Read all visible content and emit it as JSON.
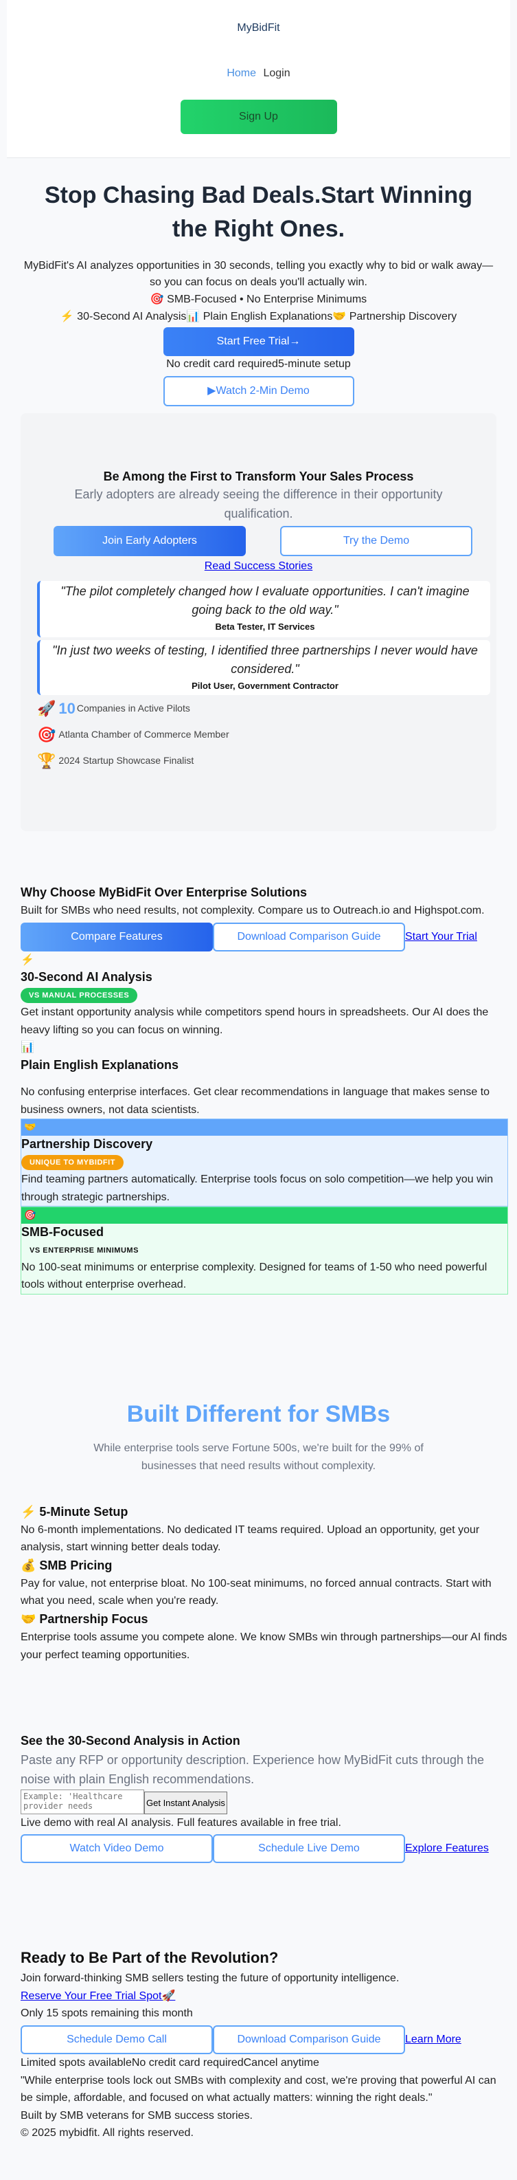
{
  "header": {
    "logo": "MyBidFit",
    "nav_home": "Home",
    "nav_login": "Login",
    "signup": "Sign Up"
  },
  "hero": {
    "title": "Stop Chasing Bad Deals.Start Winning the Right Ones.",
    "subtitle": "MyBidFit's AI analyzes opportunities in 30 seconds, telling you exactly why to bid or walk away—so you can focus on deals you'll actually win.",
    "tagline": "🎯 SMB-Focused • No Enterprise Minimums",
    "features_line": "⚡ 30-Second AI Analysis📊 Plain English Explanations🤝 Partnership Discovery",
    "cta": "Start Free Trial→",
    "note": "No credit card required5-minute setup",
    "watch": "▶Watch 2-Min Demo"
  },
  "early": {
    "title": "Be Among the First to Transform Your Sales Process",
    "lead": "Early adopters are already seeing the difference in their opportunity qualification.",
    "join": "Join Early Adopters",
    "try": "Try the Demo",
    "read": "Read Success Stories",
    "quotes": [
      {
        "text": "\"The pilot completely changed how I evaluate opportunities. I can't imagine going back to the old way.\"",
        "by": "Beta Tester, IT Services"
      },
      {
        "text": "\"In just two weeks of testing, I identified three partnerships I never would have considered.\"",
        "by": "Pilot User, Government Contractor"
      }
    ],
    "badges": [
      {
        "icon": "🚀",
        "num": "10",
        "label": "Companies in Active Pilots"
      },
      {
        "icon": "🎯",
        "label": "Atlanta Chamber of Commerce Member"
      },
      {
        "icon": "🏆",
        "label": "2024 Startup Showcase Finalist"
      }
    ]
  },
  "why": {
    "title": "Why Choose MyBidFit Over Enterprise Solutions",
    "lead": "Built for SMBs who need results, not complexity. Compare us to Outreach.io and Highspot.com.",
    "compare": "Compare Features",
    "download": "Download Comparison Guide",
    "trial": "Start Your Trial",
    "features": [
      {
        "icon": "⚡",
        "title": "30-Second AI Analysis",
        "pill": "VS MANUAL PROCESSES",
        "text": "Get instant opportunity analysis while competitors spend hours in spreadsheets. Our AI does the heavy lifting so you can focus on winning."
      },
      {
        "icon": "📊",
        "title": "Plain English Explanations",
        "pill": "",
        "text": "No confusing enterprise interfaces. Get clear recommendations in language that makes sense to business owners, not data scientists."
      },
      {
        "icon": "🤝",
        "title": "Partnership Discovery",
        "pill": "UNIQUE TO MYBIDFIT",
        "text": "Find teaming partners automatically. Enterprise tools focus on solo competition—we help you win through strategic partnerships."
      },
      {
        "icon": "🎯",
        "title": "SMB-Focused",
        "pill": "VS ENTERPRISE MINIMUMS",
        "text": "No 100-seat minimums or enterprise complexity. Designed for teams of 1-50 who need powerful tools without enterprise overhead."
      }
    ]
  },
  "built": {
    "title": "Built Different for SMBs",
    "sub": "While enterprise tools serve Fortune 500s, we're built for the 99% of businesses that need results without complexity.",
    "items": [
      {
        "title": "⚡ 5-Minute Setup",
        "text": "No 6-month implementations. No dedicated IT teams required. Upload an opportunity, get your analysis, start winning better deals today."
      },
      {
        "title": "💰 SMB Pricing",
        "text": "Pay for value, not enterprise bloat. No 100-seat minimums, no forced annual contracts. Start with what you need, scale when you're ready."
      },
      {
        "title": "🤝 Partnership Focus",
        "text": "Enterprise tools assume you compete alone. We know SMBs win through partnerships—our AI finds your perfect teaming opportunities."
      }
    ]
  },
  "demo": {
    "title": "See the 30-Second Analysis in Action",
    "lead": "Paste any RFP or opportunity description. Experience how MyBidFit cuts through the noise with plain English recommendations.",
    "placeholder": "Example: 'Healthcare provider needs",
    "analyze": "Get Instant Analysis",
    "note": "Live demo with real AI analysis. Full features available in free trial.",
    "video": "Watch Video Demo",
    "schedule": "Schedule Live Demo",
    "explore": "Explore Features"
  },
  "rev": {
    "title": "Ready to Be Part of the Revolution?",
    "lead": "Join forward-thinking SMB sellers testing the future of opportunity intelligence.",
    "reserve": "Reserve Your Free Trial Spot🚀",
    "spots": "Only 15 spots remaining this month",
    "call": "Schedule Demo Call",
    "download": "Download Comparison Guide",
    "learn": "Learn More",
    "limited": "Limited spots availableNo credit card requiredCancel anytime",
    "quote": "\"While enterprise tools lock out SMBs with complexity and cost, we're proving that powerful AI can be simple, affordable, and focused on what actually matters: winning the right deals.\"",
    "built_by": "Built by SMB veterans for SMB success stories.",
    "copyright": "© 2025 mybidfit. All rights reserved."
  }
}
